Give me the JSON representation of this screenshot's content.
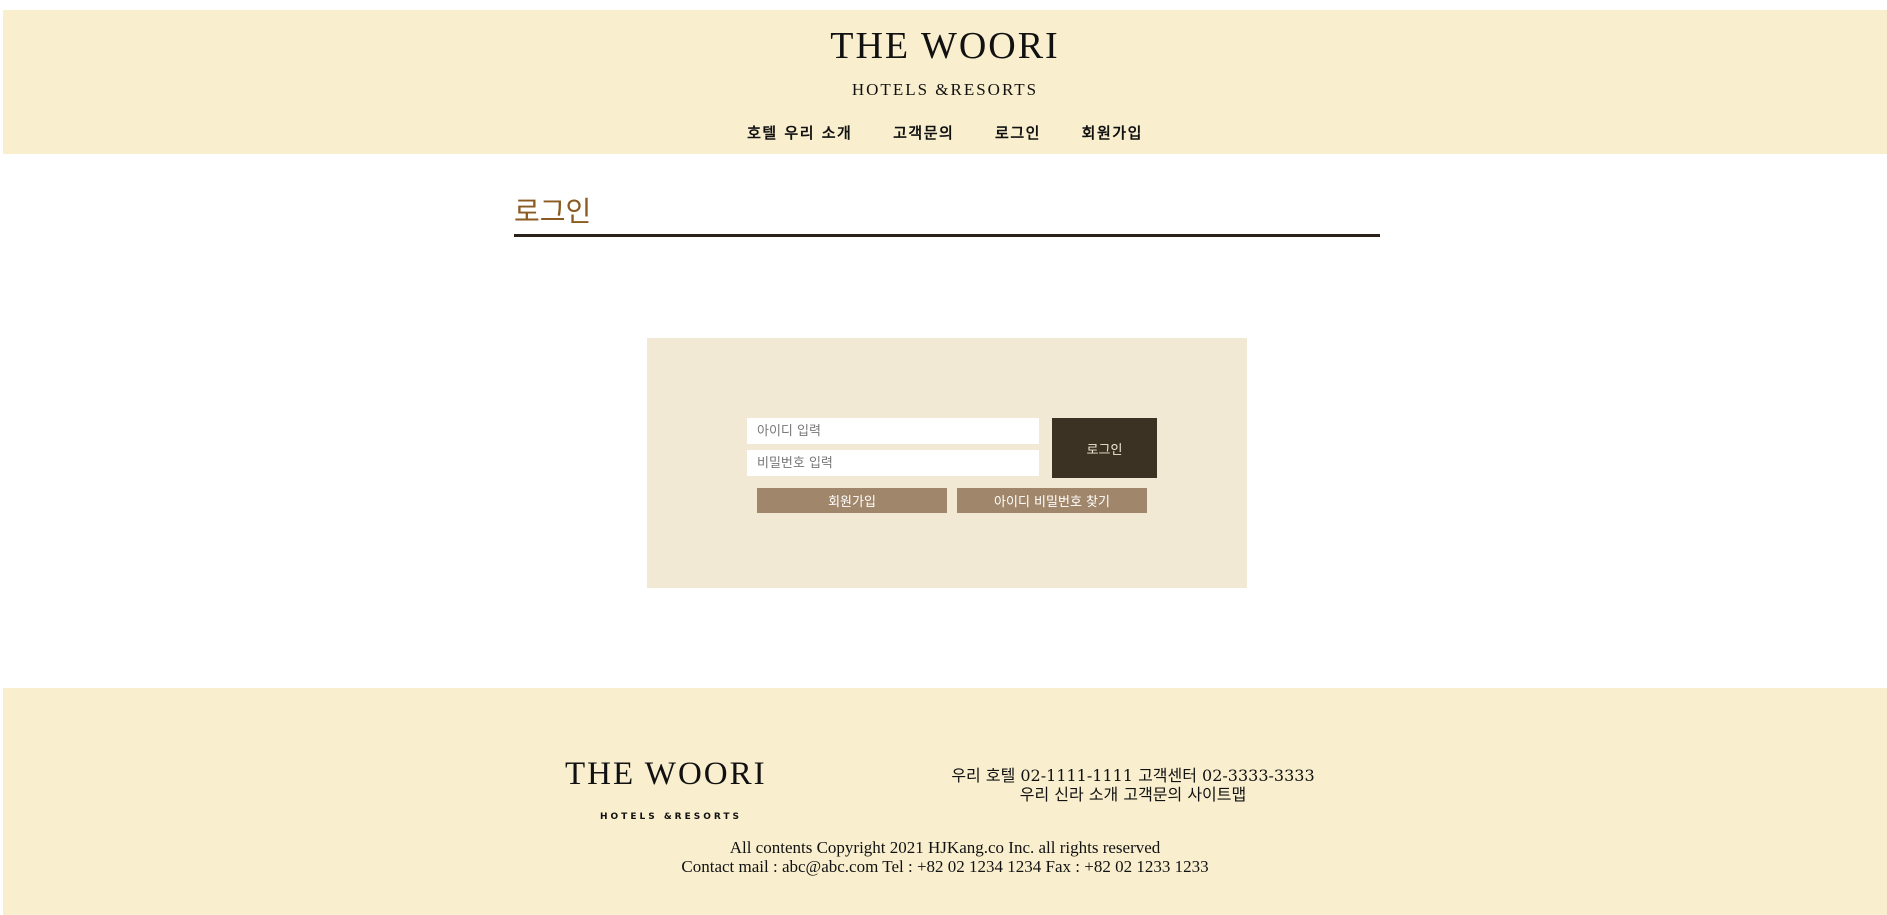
{
  "header": {
    "logo_title": "THE WOORI",
    "logo_sub": "HOTELS &RESORTS",
    "nav": [
      "호텔 우리 소개",
      "고객문의",
      "로그인",
      "회원가입"
    ]
  },
  "page": {
    "title": "로그인"
  },
  "login": {
    "id_placeholder": "아이디 입력",
    "pw_placeholder": "비밀번호 입력",
    "login_button": "로그인",
    "join_button": "회원가입",
    "find_button": "아이디 비밀번호 찾기"
  },
  "footer": {
    "logo_title": "THE WOORI",
    "logo_sub": "HOTELS &RESORTS",
    "info_line1": "우리 호텔 02-1111-1111 고객센터 02-3333-3333",
    "info_line2": "우리 신라 소개 고객문의 사이트맵",
    "copyright": "All contents Copyright 2021 HJKang.co Inc. all rights reserved",
    "contact": "Contact mail : abc@abc.com Tel : +82 02 1234 1234 Fax : +82 02 1233 1233"
  },
  "colors": {
    "header_bg": "#f9efcf",
    "title_accent": "#8a5a20",
    "login_box_bg": "#f1e9d4",
    "login_button_bg": "#3b3224",
    "secondary_button_bg": "#a0866a"
  }
}
